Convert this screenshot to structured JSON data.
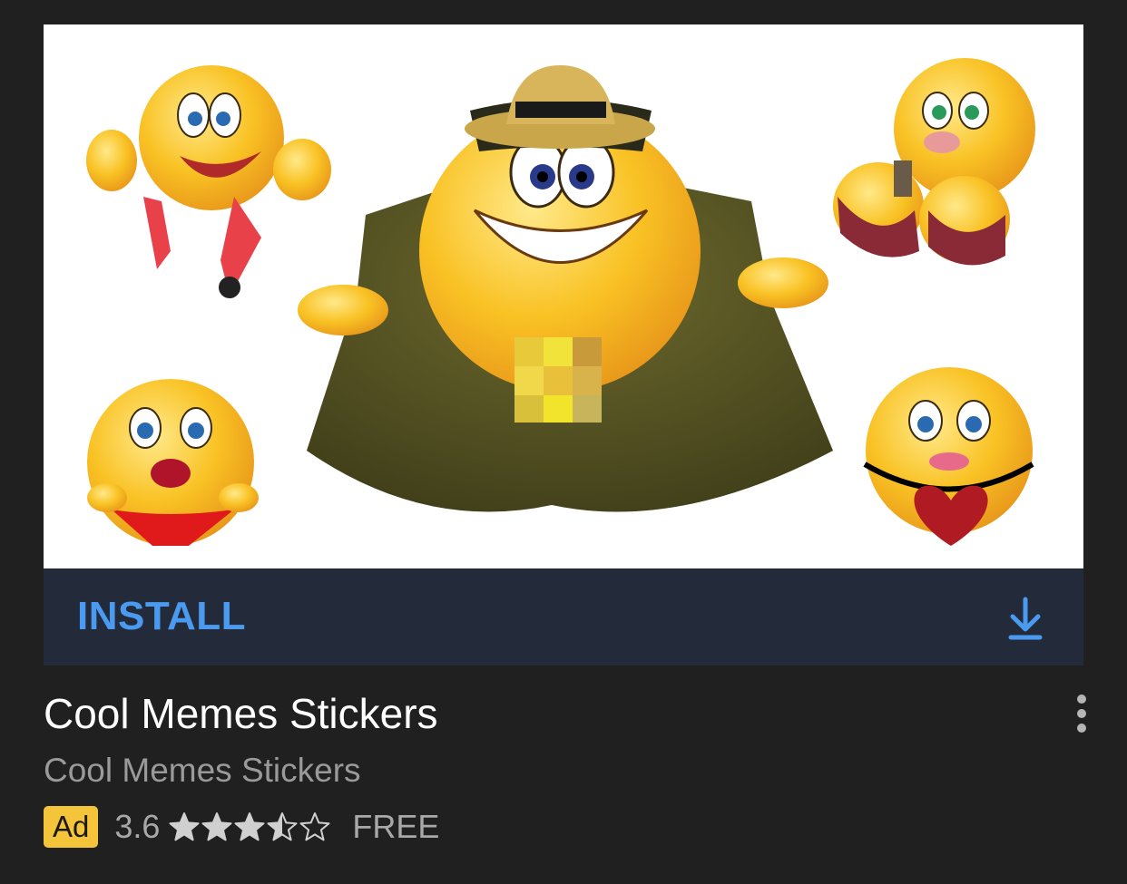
{
  "ad": {
    "install_label": "INSTALL",
    "title": "Cool Memes Stickers",
    "developer": "Cool Memes Stickers",
    "badge": "Ad",
    "rating": "3.6",
    "rating_stars": 3.6,
    "price": "FREE"
  },
  "icons": {
    "download": "download-icon",
    "more": "more-vert-icon",
    "star": "star-icon"
  },
  "colors": {
    "background": "#202020",
    "install_bar": "#232a3a",
    "accent": "#4a9af0",
    "badge": "#f4c43a"
  }
}
